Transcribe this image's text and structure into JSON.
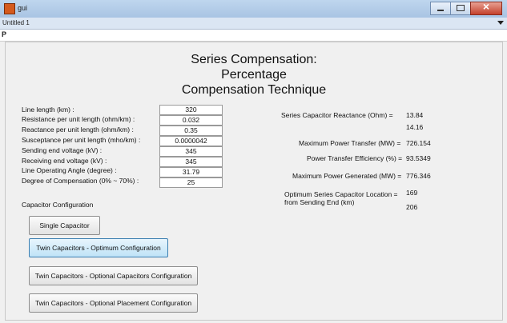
{
  "window": {
    "app_title": "gui",
    "doc_tab": "Untitled 1",
    "toolbar_icon": "P"
  },
  "title": {
    "line1": "Series Compensation:",
    "line2": "Percentage",
    "line3": "Compensation Technique"
  },
  "inputs": [
    {
      "label": "Line length (km) :",
      "value": "320"
    },
    {
      "label": "Resistance per unit length (ohm/km) :",
      "value": "0.032"
    },
    {
      "label": "Reactance per unit length (ohm/km) :",
      "value": "0.35"
    },
    {
      "label": "Susceptance per unit length (mho/km) :",
      "value": "0.0000042"
    },
    {
      "label": "Sending end voltage (kV) :",
      "value": "345"
    },
    {
      "label": "Receiving end voltage (kV) :",
      "value": "345"
    },
    {
      "label": "Line Operating Angle (degree) :",
      "value": "31.79"
    },
    {
      "label": "Degree of Compensation (0% ~ 70%) :",
      "value": "25"
    }
  ],
  "capacitor_config_label": "Capacitor Configuration",
  "buttons": {
    "single": "Single Capacitor",
    "twin_optimum": "Twin Capacitors - Optimum Configuration",
    "twin_optional_cap": "Twin Capacitors - Optional Capacitors Configuration",
    "twin_optional_place": "Twin Capacitors - Optional Placement Configuration"
  },
  "results": {
    "reactance_label": "Series Capacitor Reactance (Ohm) =",
    "reactance_value_1": "13.84",
    "reactance_value_2": "14.16",
    "max_power_label": "Maximum Power Transfer (MW) =",
    "max_power_value": "726.154",
    "efficiency_label": "Power Transfer Efficiency (%) =",
    "efficiency_value": "93.5349",
    "max_generated_label": "Maximum Power Generated (MW) =",
    "max_generated_value": "776.346",
    "location_label_1": "Optimum Series Capacitor Location =",
    "location_label_2": "from Sending End (km)",
    "location_value_1": "169",
    "location_value_2": "206"
  },
  "colors": {
    "active_button": "#bfe3f7",
    "titlebar": "#bfd6ee",
    "close_button": "#c4412c"
  }
}
